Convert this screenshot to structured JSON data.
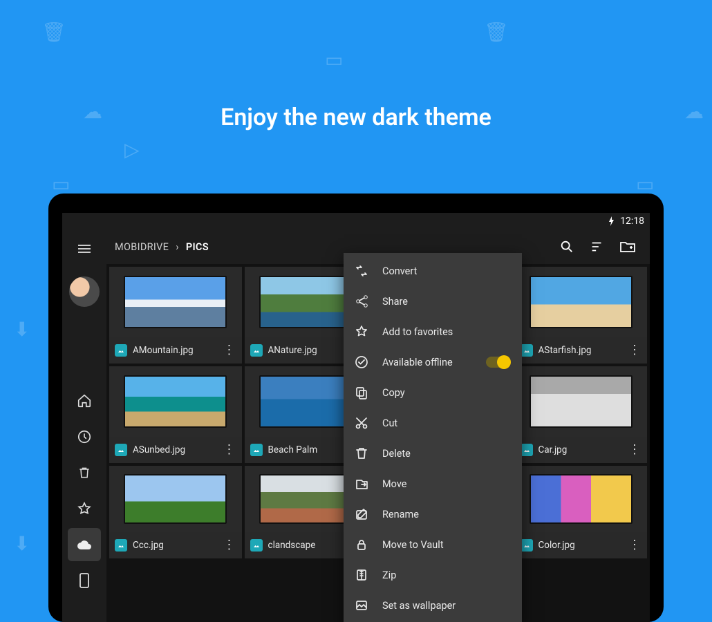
{
  "hero": {
    "headline": "Enjoy the new dark theme"
  },
  "status": {
    "time": "12:18"
  },
  "breadcrumbs": {
    "root": "MOBIDRIVE",
    "current": "PICS"
  },
  "sidebar": {
    "items": [
      "home",
      "recent",
      "trash",
      "favorites",
      "cloud",
      "device"
    ],
    "active_index": 4
  },
  "files": [
    {
      "name": "AMountain.jpg",
      "thumb": "g-mountain"
    },
    {
      "name": "ANature.jpg",
      "thumb": "g-nature"
    },
    {
      "name": "",
      "thumb": ""
    },
    {
      "name": "AStarfish.jpg",
      "thumb": "g-starfish"
    },
    {
      "name": "ASunbed.jpg",
      "thumb": "g-sunbed"
    },
    {
      "name": "Beach Palm",
      "thumb": "g-palm"
    },
    {
      "name": "",
      "thumb": ""
    },
    {
      "name": "Car.jpg",
      "thumb": "g-car"
    },
    {
      "name": "Ccc.jpg",
      "thumb": "g-ccc"
    },
    {
      "name": "clandscape",
      "thumb": "g-land"
    },
    {
      "name": "",
      "thumb": ""
    },
    {
      "name": "Color.jpg",
      "thumb": "g-color"
    }
  ],
  "menu": [
    {
      "icon": "convert",
      "label": "Convert"
    },
    {
      "icon": "share",
      "label": "Share"
    },
    {
      "icon": "star",
      "label": "Add to favorites"
    },
    {
      "icon": "check",
      "label": "Available offline",
      "toggle": true
    },
    {
      "icon": "copy",
      "label": "Copy"
    },
    {
      "icon": "cut",
      "label": "Cut"
    },
    {
      "icon": "trash",
      "label": "Delete"
    },
    {
      "icon": "move",
      "label": "Move"
    },
    {
      "icon": "rename",
      "label": "Rename"
    },
    {
      "icon": "vault",
      "label": "Move to Vault"
    },
    {
      "icon": "zip",
      "label": "Zip"
    },
    {
      "icon": "wallpaper",
      "label": "Set as wallpaper"
    }
  ]
}
